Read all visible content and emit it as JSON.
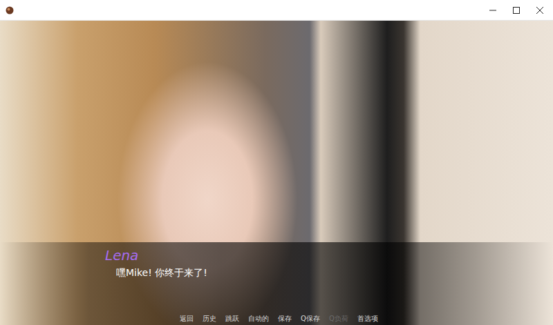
{
  "dialogue": {
    "speaker": "Lena",
    "line": "嘿Mike! 你终于来了!"
  },
  "quick_menu": [
    {
      "label": "返回",
      "disabled": false
    },
    {
      "label": "历史",
      "disabled": false
    },
    {
      "label": "跳跃",
      "disabled": false
    },
    {
      "label": "自动的",
      "disabled": false
    },
    {
      "label": "保存",
      "disabled": false
    },
    {
      "label": "Q保存",
      "disabled": false
    },
    {
      "label": "Q负荷",
      "disabled": true
    },
    {
      "label": "首选项",
      "disabled": false
    }
  ]
}
